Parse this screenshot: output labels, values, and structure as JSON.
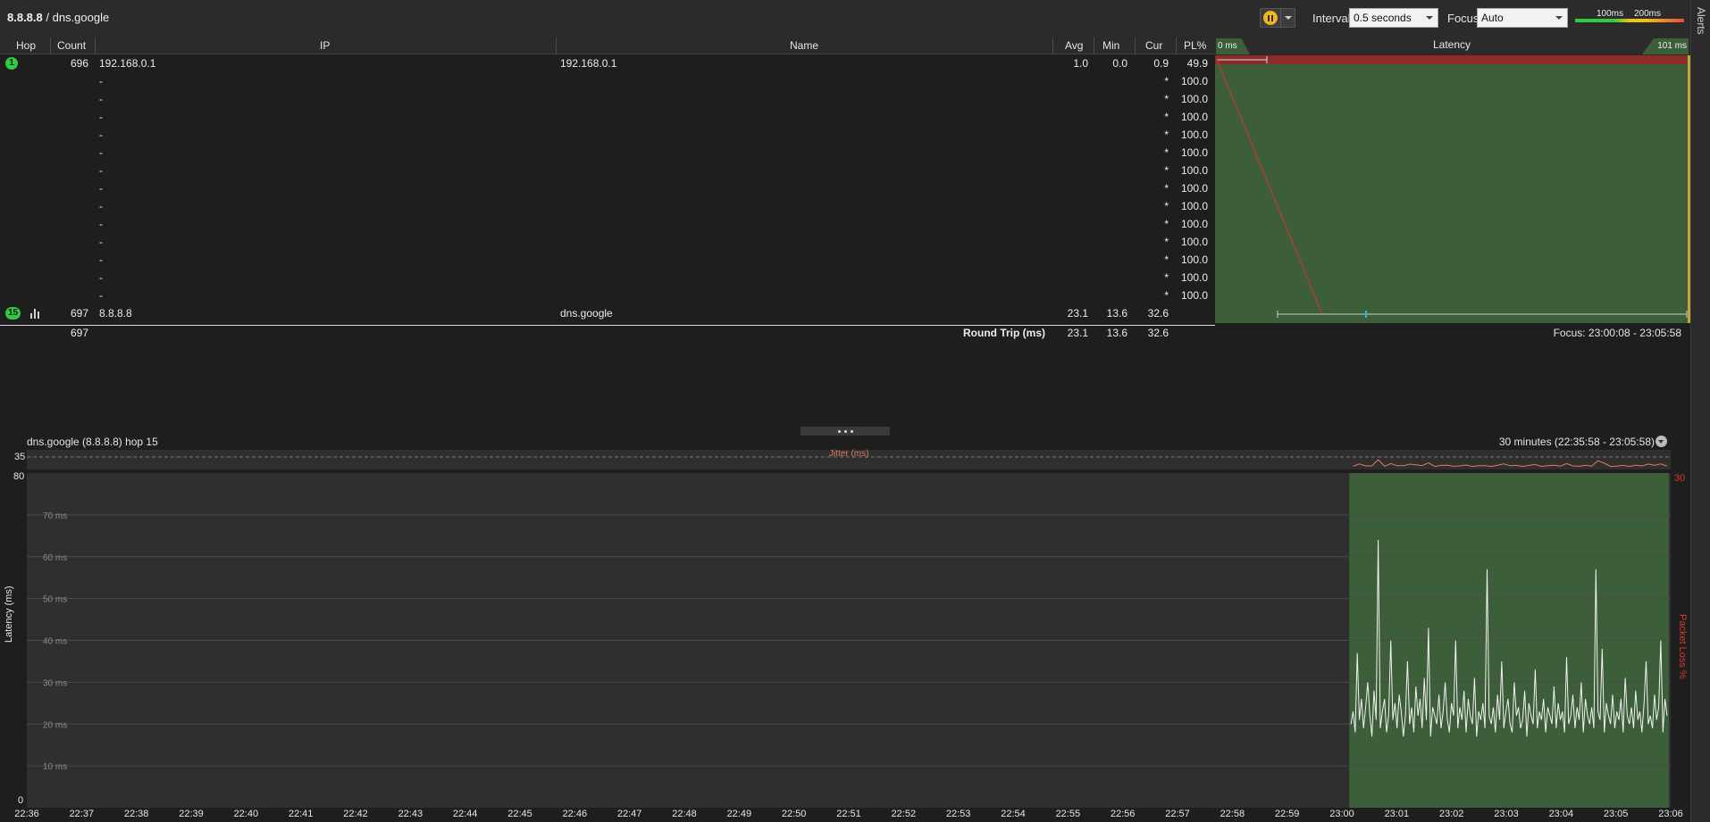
{
  "header": {
    "target_ip": "8.8.8.8",
    "target_sep": " / ",
    "target_name": "dns.google",
    "interval_label": "Interval",
    "interval_value": "0.5 seconds",
    "focus_label": "Focus",
    "focus_value": "Auto",
    "legend_100": "100ms",
    "legend_200": "200ms",
    "alerts_label": "Alerts",
    "icons": [
      "pause-icon",
      "chevron-down-icon"
    ],
    "colors": {
      "accent_pause": "#f0b41c",
      "good": "#2ecc40",
      "warn": "#f1c40f",
      "bad": "#e74c3c"
    }
  },
  "table": {
    "columns": [
      "Hop",
      "Count",
      "IP",
      "Name",
      "Avg",
      "Min",
      "Cur",
      "PL%"
    ],
    "rows": [
      {
        "hop": "1",
        "count": "696",
        "ip": "192.168.0.1",
        "name": "192.168.0.1",
        "avg": "1.0",
        "min": "0.0",
        "cur": "0.9",
        "pl": "49.9"
      },
      {
        "hop": "",
        "count": "",
        "ip": "-",
        "name": "",
        "avg": "",
        "min": "",
        "cur": "*",
        "pl": "100.0"
      },
      {
        "hop": "",
        "count": "",
        "ip": "-",
        "name": "",
        "avg": "",
        "min": "",
        "cur": "*",
        "pl": "100.0"
      },
      {
        "hop": "",
        "count": "",
        "ip": "-",
        "name": "",
        "avg": "",
        "min": "",
        "cur": "*",
        "pl": "100.0"
      },
      {
        "hop": "",
        "count": "",
        "ip": "-",
        "name": "",
        "avg": "",
        "min": "",
        "cur": "*",
        "pl": "100.0"
      },
      {
        "hop": "",
        "count": "",
        "ip": "-",
        "name": "",
        "avg": "",
        "min": "",
        "cur": "*",
        "pl": "100.0"
      },
      {
        "hop": "",
        "count": "",
        "ip": "-",
        "name": "",
        "avg": "",
        "min": "",
        "cur": "*",
        "pl": "100.0"
      },
      {
        "hop": "",
        "count": "",
        "ip": "-",
        "name": "",
        "avg": "",
        "min": "",
        "cur": "*",
        "pl": "100.0"
      },
      {
        "hop": "",
        "count": "",
        "ip": "-",
        "name": "",
        "avg": "",
        "min": "",
        "cur": "*",
        "pl": "100.0"
      },
      {
        "hop": "",
        "count": "",
        "ip": "-",
        "name": "",
        "avg": "",
        "min": "",
        "cur": "*",
        "pl": "100.0"
      },
      {
        "hop": "",
        "count": "",
        "ip": "-",
        "name": "",
        "avg": "",
        "min": "",
        "cur": "*",
        "pl": "100.0"
      },
      {
        "hop": "",
        "count": "",
        "ip": "-",
        "name": "",
        "avg": "",
        "min": "",
        "cur": "*",
        "pl": "100.0"
      },
      {
        "hop": "",
        "count": "",
        "ip": "-",
        "name": "",
        "avg": "",
        "min": "",
        "cur": "*",
        "pl": "100.0"
      },
      {
        "hop": "",
        "count": "",
        "ip": "-",
        "name": "",
        "avg": "",
        "min": "",
        "cur": "*",
        "pl": "100.0"
      },
      {
        "hop": "15",
        "count": "697",
        "ip": "8.8.8.8",
        "name": "dns.google",
        "avg": "23.1",
        "min": "13.6",
        "cur": "32.6",
        "pl": ""
      }
    ],
    "total": {
      "count": "697",
      "label": "Round Trip (ms)",
      "avg": "23.1",
      "min": "13.6",
      "cur": "32.6"
    },
    "hop_icons": [
      "bar-chart-icon"
    ]
  },
  "latency_panel": {
    "title": "Latency",
    "min_label": "0 ms",
    "max_label": "101 ms",
    "focus_range": "Focus: 23:00:08 - 23:05:58",
    "colors": {
      "bg": "#3c5e38",
      "loss_band": "#8b2c28",
      "trace": "#c0392b"
    }
  },
  "graph": {
    "title": "dns.google (8.8.8.8) hop 15",
    "range": "30 minutes (22:35:58 - 23:05:58)",
    "jitter_label": "Jitter (ms)",
    "jitter_max": "35",
    "y_axis_title": "Latency (ms)",
    "pl_axis_title": "Packet Loss %",
    "pl_max": "30",
    "y_top": "80",
    "y_bottom": "0",
    "y_gridlabels": [
      "70 ms",
      "60 ms",
      "50 ms",
      "40 ms",
      "30 ms",
      "20 ms",
      "10 ms"
    ],
    "x_ticks": [
      "22:36",
      "22:37",
      "22:38",
      "22:39",
      "22:40",
      "22:41",
      "22:42",
      "22:43",
      "22:44",
      "22:45",
      "22:46",
      "22:47",
      "22:48",
      "22:49",
      "22:50",
      "22:51",
      "22:52",
      "22:53",
      "22:54",
      "22:55",
      "22:56",
      "22:57",
      "22:58",
      "22:59",
      "23:00",
      "23:01",
      "23:02",
      "23:03",
      "23:04",
      "23:05",
      "23:06"
    ],
    "icons": [
      "chevron-down-icon"
    ]
  },
  "chart_data": {
    "type": "line",
    "ylabel": "Latency (ms)",
    "ylim": [
      0,
      80
    ],
    "x_start": "22:36",
    "x_end": "23:06",
    "focus_window": [
      "23:00:08",
      "23:05:58"
    ],
    "series": [
      {
        "values": [
          20,
          23,
          18,
          37,
          21,
          26,
          19,
          24,
          30,
          22,
          17,
          28,
          21,
          64,
          19,
          23,
          26,
          18,
          22,
          40,
          21,
          25,
          19,
          27,
          23,
          17,
          22,
          35,
          20,
          24,
          18,
          29,
          22,
          26,
          19,
          31,
          21,
          43,
          17,
          24,
          22,
          20,
          27,
          19,
          23,
          30,
          21,
          18,
          25,
          22,
          40,
          19,
          24,
          21,
          28,
          18,
          26,
          22,
          20,
          31,
          17,
          23,
          21,
          25,
          19,
          57,
          22,
          20,
          24,
          18,
          27,
          21,
          35,
          19,
          23,
          26,
          20,
          18,
          30,
          22,
          24,
          19,
          21,
          28,
          17,
          25,
          22,
          20,
          33,
          19,
          23,
          21,
          26,
          18,
          24,
          22,
          20,
          29,
          19,
          25,
          21,
          23,
          18,
          36,
          20,
          22,
          27,
          19,
          24,
          21,
          30,
          18,
          26,
          22,
          20,
          24,
          19,
          57,
          23,
          21,
          38,
          18,
          25,
          22,
          20,
          27,
          19,
          23,
          21,
          26,
          18,
          31,
          22,
          20,
          24,
          19,
          28,
          21,
          23,
          18,
          25,
          35,
          20,
          22,
          19,
          27,
          21,
          24,
          40,
          18,
          26,
          22
        ]
      }
    ]
  }
}
